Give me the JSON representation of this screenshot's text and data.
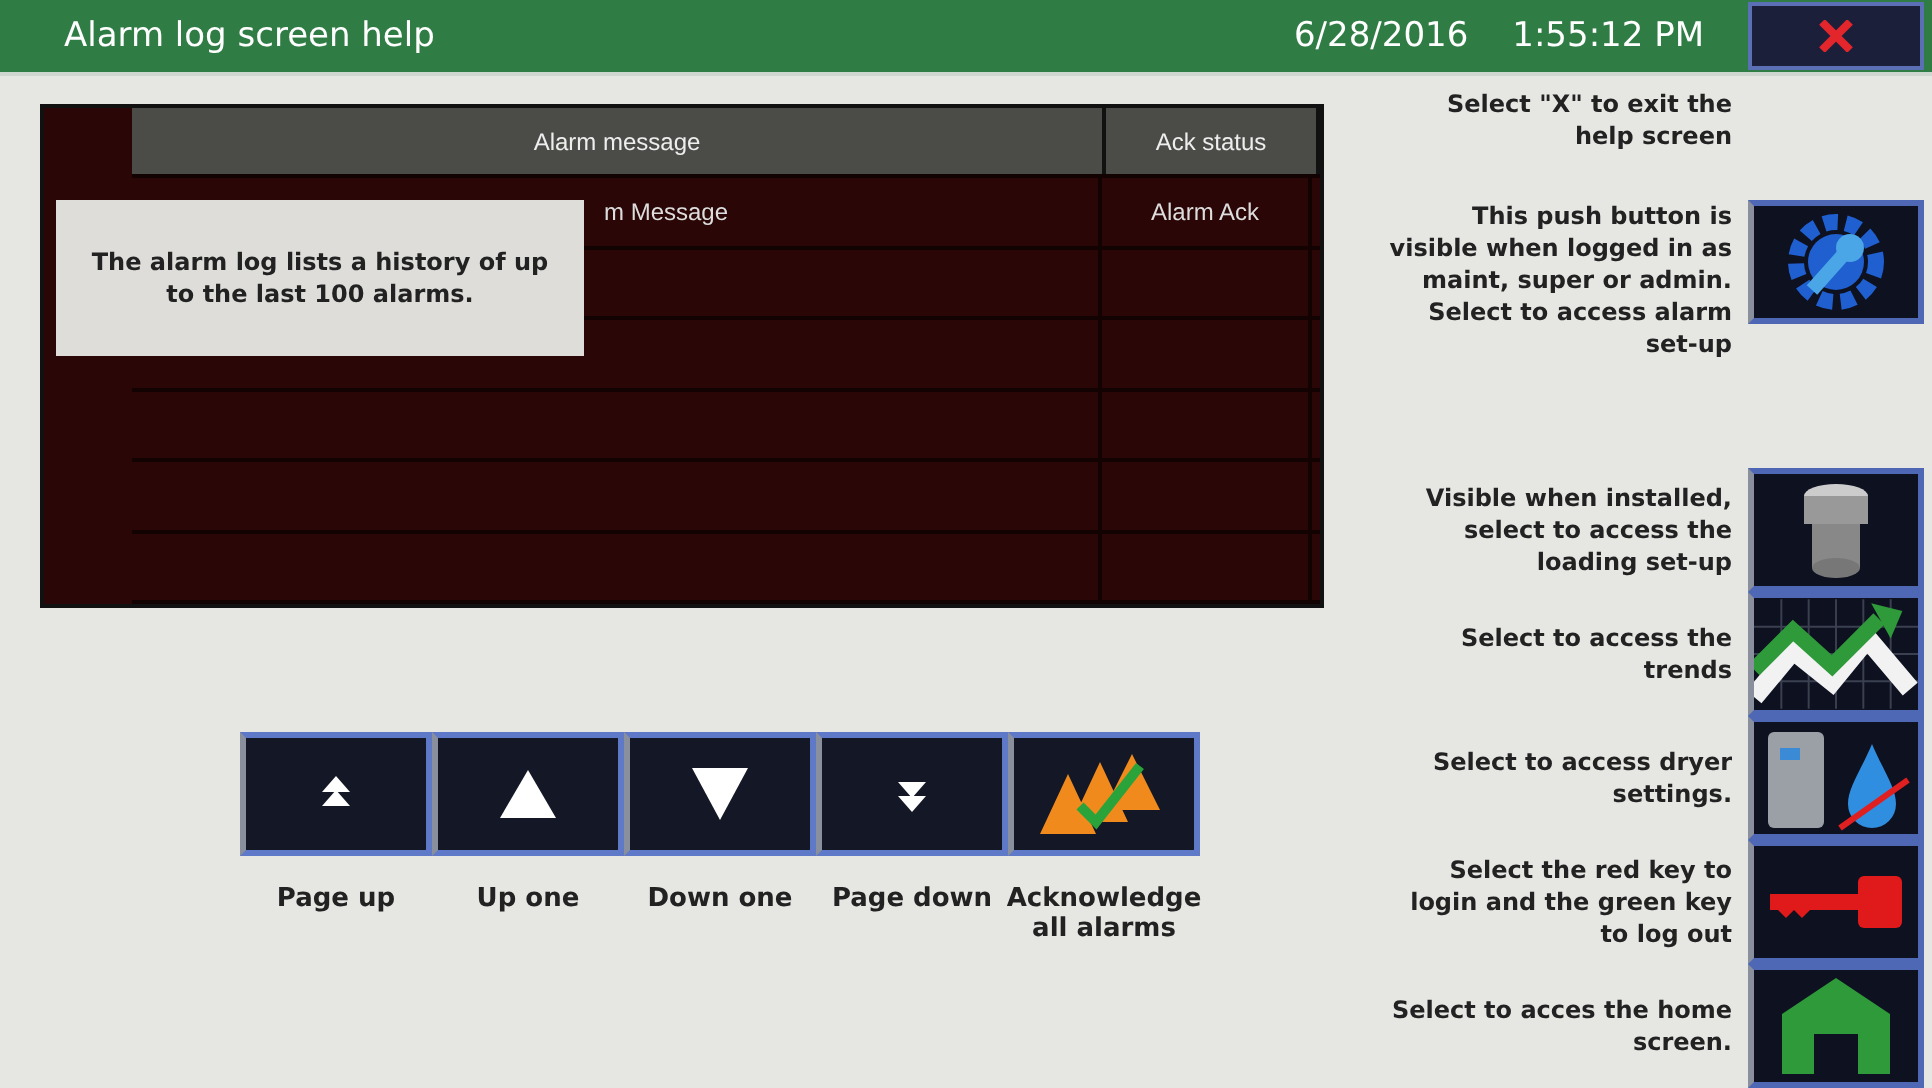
{
  "window": {
    "title": "Alarm log screen help",
    "date": "6/28/2016",
    "time": "1:55:12 PM"
  },
  "exit_help": "Select \"X\" to exit the help screen",
  "table": {
    "columns": [
      "Alarm message",
      "Ack status"
    ],
    "rows": [
      {
        "message": "m Message",
        "ack": "Alarm Ack"
      }
    ]
  },
  "tooltip": "The alarm log lists a history of up to the last 100 alarms.",
  "nav_buttons": [
    {
      "kind": "page-up",
      "label": "Page up"
    },
    {
      "kind": "up",
      "label": "Up one"
    },
    {
      "kind": "down",
      "label": "Down one"
    },
    {
      "kind": "page-down",
      "label": "Page down"
    },
    {
      "kind": "acknowledge",
      "label": "Acknowledge all alarms"
    }
  ],
  "side_buttons": [
    {
      "kind": "settings",
      "help": "This push button is visible when logged in as maint, super or admin. Select to access alarm set-up"
    },
    {
      "kind": "loading",
      "help": "Visible when installed, select to access the loading set-up"
    },
    {
      "kind": "trends",
      "help": "Select to access the trends"
    },
    {
      "kind": "dryer",
      "help": "Select to access dryer settings."
    },
    {
      "kind": "key",
      "help": "Select the red key to login and the green key to log out"
    },
    {
      "kind": "home",
      "help": "Select to acces the home screen."
    }
  ]
}
